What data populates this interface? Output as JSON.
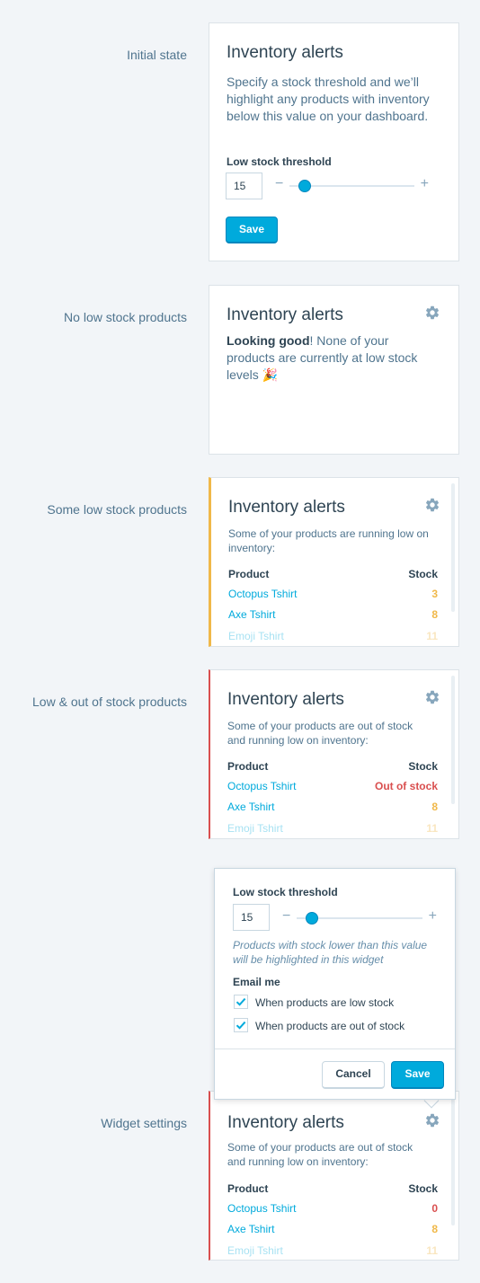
{
  "rows": [
    {
      "label": "Initial state"
    },
    {
      "label": "No low stock products"
    },
    {
      "label": "Some low stock products"
    },
    {
      "label": "Low & out of stock products"
    },
    {
      "label": "Widget settings"
    }
  ],
  "card_title": "Inventory alerts",
  "initial": {
    "description": "Specify a stock threshold and we’ll highlight any products with inventory below this value on your dashboard.",
    "threshold_label": "Low stock threshold",
    "threshold_value": "15",
    "save_label": "Save",
    "slider_fraction": 0.2
  },
  "no_low": {
    "bold": "Looking good",
    "rest": "! None of your products are currently at low stock levels",
    "emoji": "🎉"
  },
  "some_low": {
    "description": "Some of your products are running low on inventory:",
    "col_product": "Product",
    "col_stock": "Stock",
    "items": [
      {
        "product": "Octopus Tshirt",
        "stock": "3"
      },
      {
        "product": "Axe Tshirt",
        "stock": "8"
      },
      {
        "product": "Emoji Tshirt",
        "stock": "11"
      }
    ]
  },
  "out_of_stock": {
    "description": "Some of your products are out of stock and running low on inventory:",
    "col_product": "Product",
    "col_stock": "Stock",
    "items": [
      {
        "product": "Octopus Tshirt",
        "stock": "Out of stock"
      },
      {
        "product": "Axe Tshirt",
        "stock": "8"
      },
      {
        "product": "Emoji Tshirt",
        "stock": "11"
      }
    ]
  },
  "settings": {
    "threshold_label": "Low stock threshold",
    "threshold_value": "15",
    "hint": "Products with stock lower than this value will be highlighted in this widget",
    "email_label": "Email me",
    "email_low": "When products are low stock",
    "email_out": "When products are out of stock",
    "cancel_label": "Cancel",
    "save_label": "Save",
    "description": "Some of your products are out of stock and running low on inventory:",
    "col_product": "Product",
    "col_stock": "Stock",
    "items": [
      {
        "product": "Octopus Tshirt",
        "stock": "0"
      },
      {
        "product": "Axe Tshirt",
        "stock": "8"
      },
      {
        "product": "Emoji Tshirt",
        "stock": "11"
      }
    ]
  },
  "colors": {
    "accent": "#00aadc",
    "warning": "#f0b849",
    "error": "#d94f4f"
  },
  "icons": [
    "gear-icon",
    "minus-icon",
    "plus-icon",
    "checkbox-checked-icon"
  ]
}
